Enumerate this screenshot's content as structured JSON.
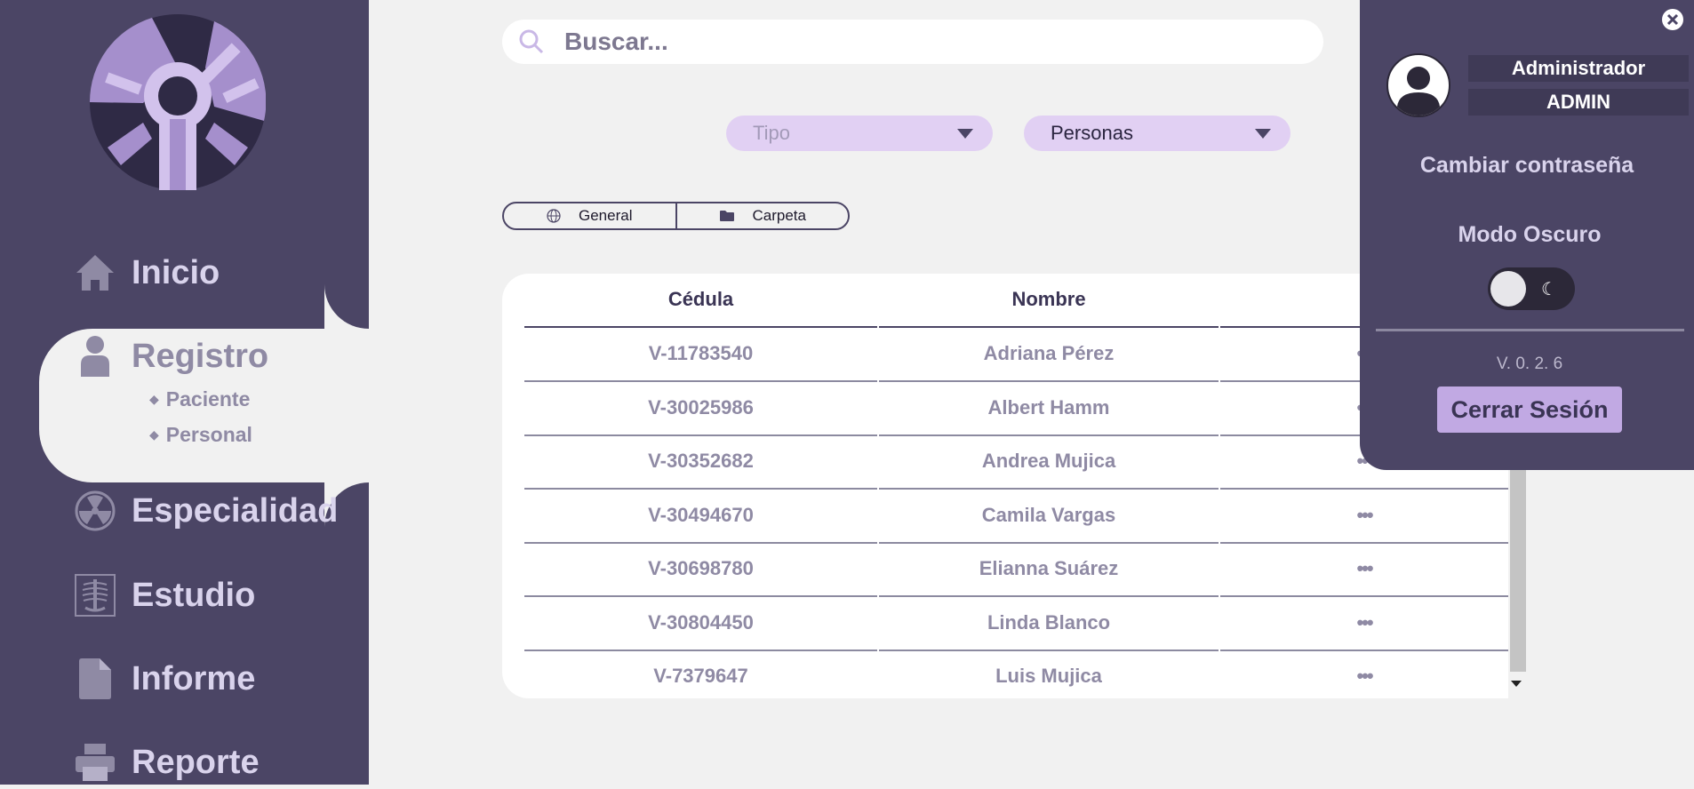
{
  "search": {
    "placeholder": "Buscar..."
  },
  "filters": {
    "tipo": "Tipo",
    "personas": "Personas"
  },
  "segments": [
    {
      "label": "General",
      "icon": "globe-icon"
    },
    {
      "label": "Carpeta",
      "icon": "folder-icon"
    }
  ],
  "sidebar": {
    "items": [
      {
        "label": "Inicio",
        "icon": "home-icon"
      },
      {
        "label": "Registro",
        "icon": "person-icon",
        "active": true,
        "sub": [
          "Paciente",
          "Personal"
        ]
      },
      {
        "label": "Especialidad",
        "icon": "radiation-icon"
      },
      {
        "label": "Estudio",
        "icon": "xray-icon"
      },
      {
        "label": "Informe",
        "icon": "document-icon"
      },
      {
        "label": "Reporte",
        "icon": "printer-icon"
      }
    ]
  },
  "table": {
    "headers": [
      "Cédula",
      "Nombre"
    ],
    "rows": [
      {
        "cedula": "V-11783540",
        "nombre": "Adriana Pérez",
        "action": "•••"
      },
      {
        "cedula": "V-30025986",
        "nombre": "Albert Hamm",
        "action": "•••"
      },
      {
        "cedula": "V-30352682",
        "nombre": "Andrea Mujica",
        "action": "•••"
      },
      {
        "cedula": "V-30494670",
        "nombre": "Camila Vargas",
        "action": "•••"
      },
      {
        "cedula": "V-30698780",
        "nombre": "Elianna Suárez",
        "action": "•••"
      },
      {
        "cedula": "V-30804450",
        "nombre": "Linda Blanco",
        "action": "•••"
      },
      {
        "cedula": "V-7379647",
        "nombre": "Luis Mujica",
        "action": "•••"
      }
    ]
  },
  "profile": {
    "role": "Administrador",
    "username": "ADMIN",
    "change_password": "Cambiar contraseña",
    "dark_mode": "Modo Oscuro",
    "dark_mode_on": false,
    "version": "V. 0. 2. 6",
    "logout": "Cerrar Sesión"
  },
  "colors": {
    "sidebar": "#4b4565",
    "background": "#f1f1f1",
    "accent": "#c1a9e3"
  }
}
